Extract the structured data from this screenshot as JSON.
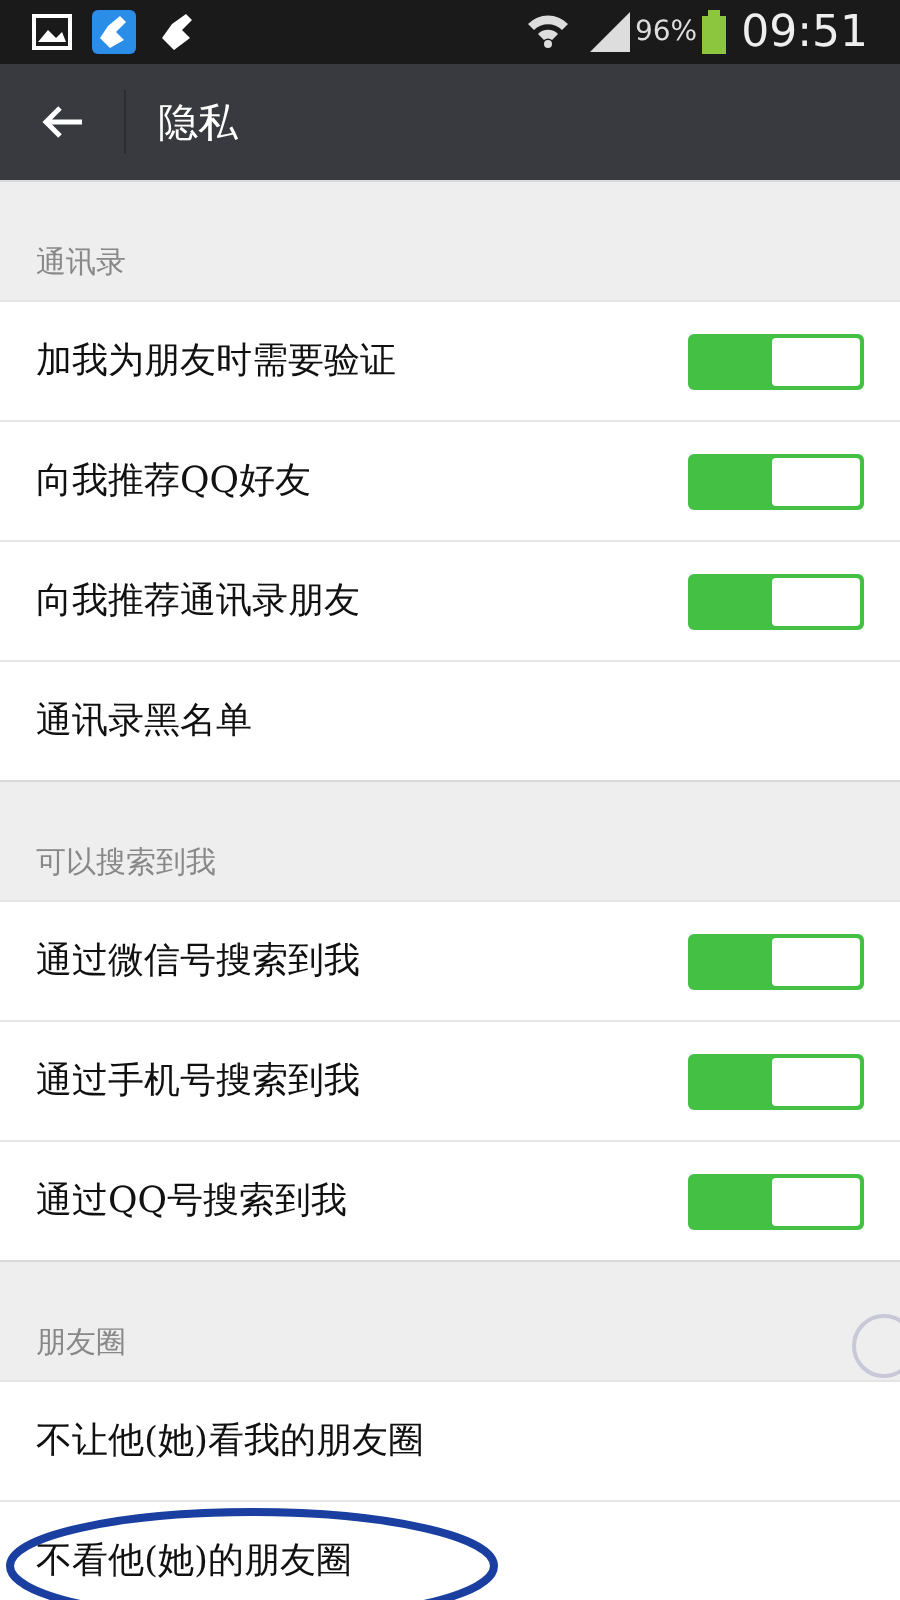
{
  "status_bar": {
    "battery": "96%",
    "time": "09:51"
  },
  "title": "隐私",
  "sections": [
    {
      "title": "通讯录",
      "items": [
        {
          "label": "加我为朋友时需要验证",
          "kind": "toggle",
          "on": true,
          "highlighted": false
        },
        {
          "label": "向我推荐QQ好友",
          "kind": "toggle",
          "on": true,
          "highlighted": false
        },
        {
          "label": "向我推荐通讯录朋友",
          "kind": "toggle",
          "on": true,
          "highlighted": false
        },
        {
          "label": "通讯录黑名单",
          "kind": "link",
          "highlighted": false
        }
      ]
    },
    {
      "title": "可以搜索到我",
      "items": [
        {
          "label": "通过微信号搜索到我",
          "kind": "toggle",
          "on": true,
          "highlighted": false
        },
        {
          "label": "通过手机号搜索到我",
          "kind": "toggle",
          "on": true,
          "highlighted": false
        },
        {
          "label": "通过QQ号搜索到我",
          "kind": "toggle",
          "on": true,
          "highlighted": false
        }
      ]
    },
    {
      "title": "朋友圈",
      "items": [
        {
          "label": "不让他(她)看我的朋友圈",
          "kind": "link",
          "highlighted": false
        },
        {
          "label": "不看他(她)的朋友圈",
          "kind": "link",
          "highlighted": true
        }
      ]
    }
  ]
}
